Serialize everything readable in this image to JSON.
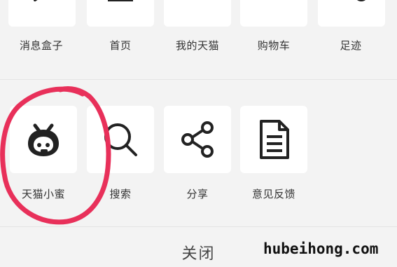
{
  "menu": {
    "row1": [
      {
        "label": "消息盒子",
        "icon": "message-box-icon"
      },
      {
        "label": "首页",
        "icon": "home-icon"
      },
      {
        "label": "我的天猫",
        "icon": "my-tmall-icon"
      },
      {
        "label": "购物车",
        "icon": "cart-icon"
      },
      {
        "label": "足迹",
        "icon": "footprint-icon"
      }
    ],
    "row2": [
      {
        "label": "天猫小蜜",
        "icon": "tmall-assistant-icon"
      },
      {
        "label": "搜索",
        "icon": "search-icon"
      },
      {
        "label": "分享",
        "icon": "share-icon"
      },
      {
        "label": "意见反馈",
        "icon": "feedback-icon"
      }
    ]
  },
  "close_label": "关闭",
  "watermark": "hubeihong.com",
  "colors": {
    "annotation": "#e8305a",
    "background": "#f3f3f3",
    "tile": "#ffffff",
    "icon": "#222222"
  }
}
